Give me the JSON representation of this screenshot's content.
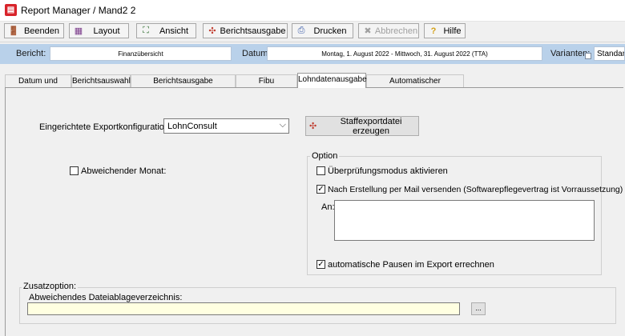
{
  "window": {
    "title": "Report Manager / Mand2 2",
    "app_icon": "report-icon"
  },
  "toolbar": {
    "buttons": [
      {
        "label": "Beenden",
        "icon": "exit-icon"
      },
      {
        "label": "Layout",
        "icon": "layout-icon"
      },
      {
        "label": "Ansicht",
        "icon": "view-icon"
      },
      {
        "label": "Berichtsausgabe",
        "icon": "report-output-icon"
      },
      {
        "label": "Drucken",
        "icon": "printer-icon"
      },
      {
        "label": "Abbrechen",
        "icon": "cancel-icon",
        "disabled": true
      },
      {
        "label": "Hilfe",
        "icon": "help-icon"
      }
    ]
  },
  "infobar": {
    "bericht_label": "Bericht:",
    "bericht_value": "Finanzübersicht",
    "datum_label": "Datum:",
    "datum_value": "Montag, 1. August 2022 - Mittwoch, 31. August 2022 (TTA)",
    "varianten_label": "Varianten:",
    "varianten_value": "Standard"
  },
  "tabs": [
    {
      "label": "Datum und Uhrzeit"
    },
    {
      "label": "Berichtsauswahl"
    },
    {
      "label": "Berichtsausgabe Einstellungen"
    },
    {
      "label": "Fibu Schnittstelle"
    },
    {
      "label": "Lohndatenausgabe",
      "active": true
    },
    {
      "label": "Automatischer Berichtsexport"
    }
  ],
  "lohn": {
    "export_label": "Eingerichtete Exportkonfigurationen:",
    "export_value": "LohnConsult",
    "create_button": "Staffexportdatei erzeugen",
    "abweichender_monat": "Abweichender Monat:",
    "abweichender_monat_checked": false,
    "option_group": "Option",
    "pruefmodus": "Überprüfungsmodus aktivieren",
    "pruefmodus_checked": false,
    "mail_versenden": "Nach Erstellung per Mail versenden (Softwarepflegevertrag ist Vorraussetzung)",
    "mail_versenden_checked": true,
    "an_label": "An:",
    "an_value": "",
    "pausen": "automatische Pausen im Export errechnen",
    "pausen_checked": true
  },
  "zusatz": {
    "group": "Zusatzoption:",
    "path_label": "Abweichendes Dateiablageverzeichnis:",
    "path_value": "",
    "browse_button": "..."
  }
}
